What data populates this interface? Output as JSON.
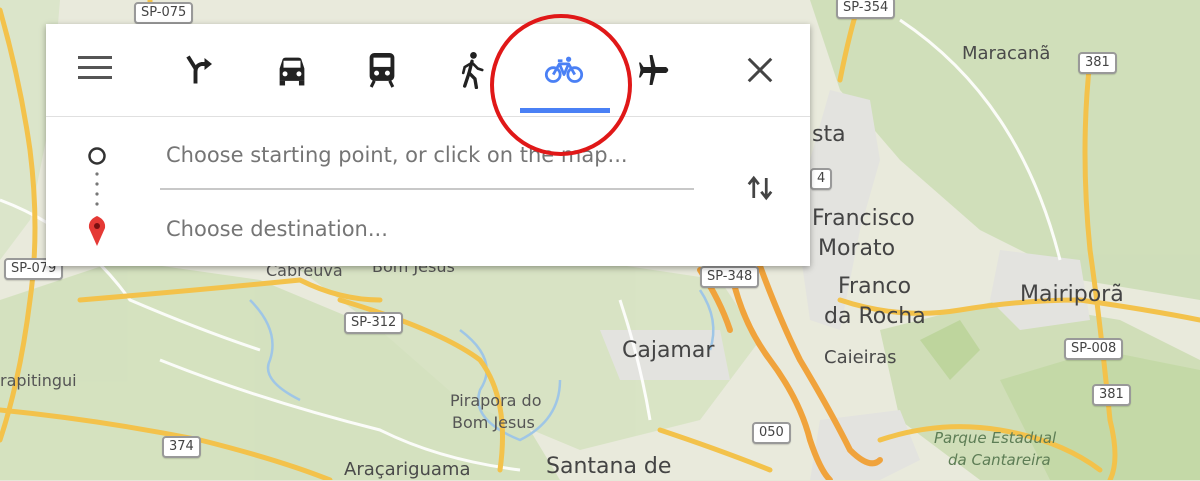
{
  "directions_panel": {
    "modes": [
      {
        "name": "best-route",
        "icon": "turn-arrow-icon",
        "selected": false
      },
      {
        "name": "driving",
        "icon": "car-icon",
        "selected": false
      },
      {
        "name": "transit",
        "icon": "train-icon",
        "selected": false
      },
      {
        "name": "walking",
        "icon": "walking-icon",
        "selected": false
      },
      {
        "name": "cycling",
        "icon": "bicycle-icon",
        "selected": true
      },
      {
        "name": "flights",
        "icon": "airplane-icon",
        "selected": false
      }
    ],
    "start_placeholder": "Choose starting point, or click on the map...",
    "destination_placeholder": "Choose destination...",
    "accent_color": "#4a80f5",
    "highlight_color": "#e01818"
  },
  "map": {
    "places": {
      "maracana": "Maracanã",
      "francisco": "Francisco",
      "morato": "Morato",
      "sta": "sta",
      "franco": "Franco",
      "da_rocha": "da Rocha",
      "mairipora": "Mairiporã",
      "cajamar": "Cajamar",
      "caieiras": "Caieiras",
      "cabreuva": "Cabreúva",
      "bom_jesus": "Bom Jesus",
      "pirapora_1": "Pirapora do",
      "pirapora_2": "Bom Jesus",
      "itapitingui": "rapitingui",
      "aracariguama": "Araçariguama",
      "santana": "Santana de",
      "park_1": "Parque Estadual",
      "park_2": "da Cantareira"
    },
    "road_shields": {
      "sp075": "SP-075",
      "sp354": "SP-354",
      "r381a": "381",
      "r381b": "381",
      "sp079": "SP-079",
      "sp348": "SP-348",
      "sp312": "SP-312",
      "sp008": "SP-008",
      "r374": "374",
      "r050": "050",
      "r4": "4"
    }
  }
}
